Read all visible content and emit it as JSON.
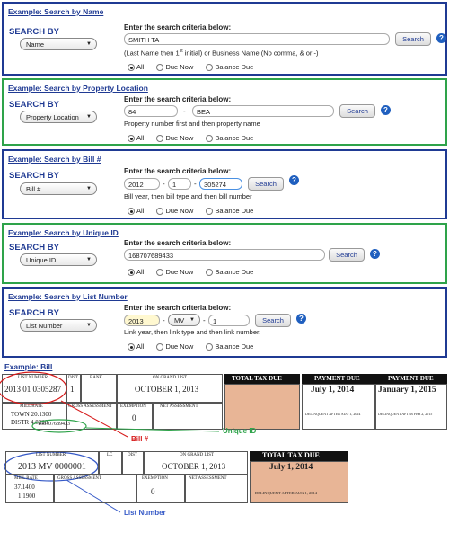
{
  "p1": {
    "title": "Example: Search by Name",
    "search_by": "SEARCH BY",
    "select": "Name",
    "criteria": "Enter the search criteria below:",
    "input": "SMITH TA",
    "note_a": "(Last Name then 1",
    "note_sup": "st",
    "note_b": " initial) or Business Name (No comma, & or -)",
    "button": "Search"
  },
  "p2": {
    "title": "Example: Search by Property Location",
    "search_by": "SEARCH BY",
    "select": "Property Location",
    "criteria": "Enter the search criteria below:",
    "input1": "84",
    "input2": "BEA",
    "note": "Property number first and then property name",
    "button": "Search"
  },
  "p3": {
    "title": "Example: Search by Bill #",
    "search_by": "SEARCH BY",
    "select": "Bill #",
    "criteria": "Enter the search criteria below:",
    "input1": "2012",
    "input2": "1",
    "input3": "305274",
    "note": "Bill year, then bill type and then bill number",
    "button": "Search"
  },
  "p4": {
    "title": "Example: Search by Unique ID",
    "search_by": "SEARCH BY",
    "select": "Unique ID",
    "criteria": "Enter the search criteria below:",
    "input": "168707689433",
    "button": "Search"
  },
  "p5": {
    "title": "Example: Search by List Number",
    "search_by": "SEARCH BY",
    "select": "List Number",
    "criteria": "Enter the search criteria below:",
    "input1": "2013",
    "input2": "MV",
    "input3": "1",
    "note": "Link year, then link type and then link number.",
    "button": "Search"
  },
  "radios": {
    "all": "All",
    "due": "Due Now",
    "bal": "Balance Due"
  },
  "help": "?",
  "dash": "-",
  "bill": {
    "title": "Example: Bill",
    "list_number_lbl": "LIST NUMBER",
    "dist_lbl": "DIST",
    "bank_lbl": "BANK",
    "grand_lbl": "ON GRAND LIST",
    "list_number": "2013 01 0305287",
    "dist": "1",
    "grand": "OCTOBER 1, 2013",
    "mill_lbl": "MILL RATE",
    "gross_lbl": "GROSS ASSESSMENT",
    "exempt_lbl": "EXEMPTION",
    "net_lbl": "NET ASSESSMENT",
    "town": "TOWN 20.1300",
    "distr": "DISTR 4.8220",
    "exempt": "0",
    "unique": "168707689433",
    "total_lbl": "TOTAL TAX DUE",
    "pay_lbl": "PAYMENT DUE",
    "pay1": "July 1, 2014",
    "pay2": "January 1, 2015",
    "del1": "DELINQUENT AFTER AUG 1, 2014",
    "del2": "DELINQUENT AFTER FEB 2, 2015",
    "ann_bill": "Bill #",
    "ann_unique": "Unique ID",
    "ann_list": "List Number"
  },
  "bill2": {
    "list_number_lbl": "LIST NUMBER",
    "lc_lbl": "LC",
    "dist_lbl": "DIST",
    "grand_lbl": "ON GRAND LIST",
    "list_number": "2013 MV 0000001",
    "grand": "OCTOBER 1, 2013",
    "mill_lbl": "MILL RATE",
    "gross_lbl": "GROSS ASSESSMENT",
    "exempt_lbl": "EXEMPTION",
    "net_lbl": "NET ASSESSMENT",
    "mill1": "37.1400",
    "mill2": "1.1900",
    "exempt": "0",
    "total_lbl": "TOTAL TAX DUE",
    "pay1": "July 1, 2014",
    "del": "DELINQUENT AFTER AUG 1, 2014"
  }
}
